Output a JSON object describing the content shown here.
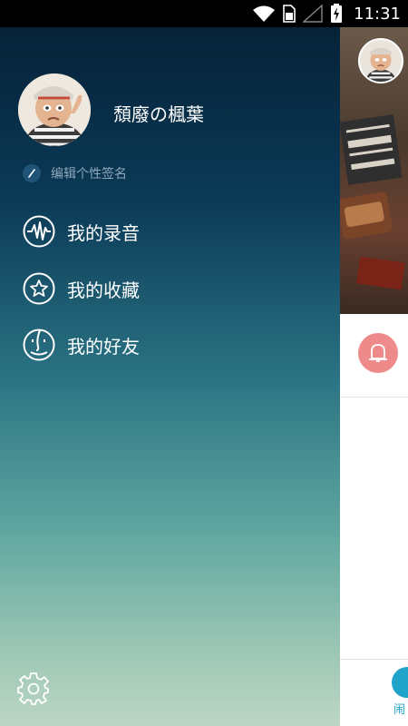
{
  "status_bar": {
    "time": "11:31",
    "icons": [
      "wifi-icon",
      "sim-card-icon",
      "signal-icon",
      "battery-charging-icon"
    ]
  },
  "drawer": {
    "username": "頹廢の楓葉",
    "signature_label": "编辑个性签名",
    "menu": [
      {
        "label": "我的录音",
        "icon": "waveform-icon"
      },
      {
        "label": "我的收藏",
        "icon": "star-icon"
      },
      {
        "label": "我的好友",
        "icon": "friend-face-icon"
      }
    ],
    "settings_icon": "gear-icon"
  },
  "background": {
    "tab_label": "闹",
    "accent_color": "#1fa3c8",
    "alarm_color": "#ef8a8a"
  }
}
